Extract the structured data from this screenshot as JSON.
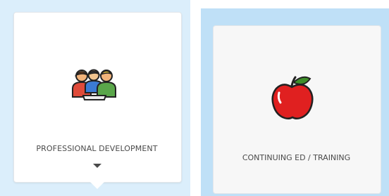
{
  "cards": [
    {
      "label": "PROFESSIONAL DEVELOPMENT",
      "icon": "team-meeting-icon",
      "state": "selected-expanded"
    },
    {
      "label": "CONTINUING ED / TRAINING",
      "icon": "apple-icon",
      "state": "normal"
    }
  ],
  "colors": {
    "selected_panel": "#dbeefb",
    "hover_panel": "#bfe0f7",
    "card_bg": "#ffffff",
    "text": "#4a4a4a",
    "apple_red": "#e02020",
    "leaf_green": "#3f8f2a"
  }
}
